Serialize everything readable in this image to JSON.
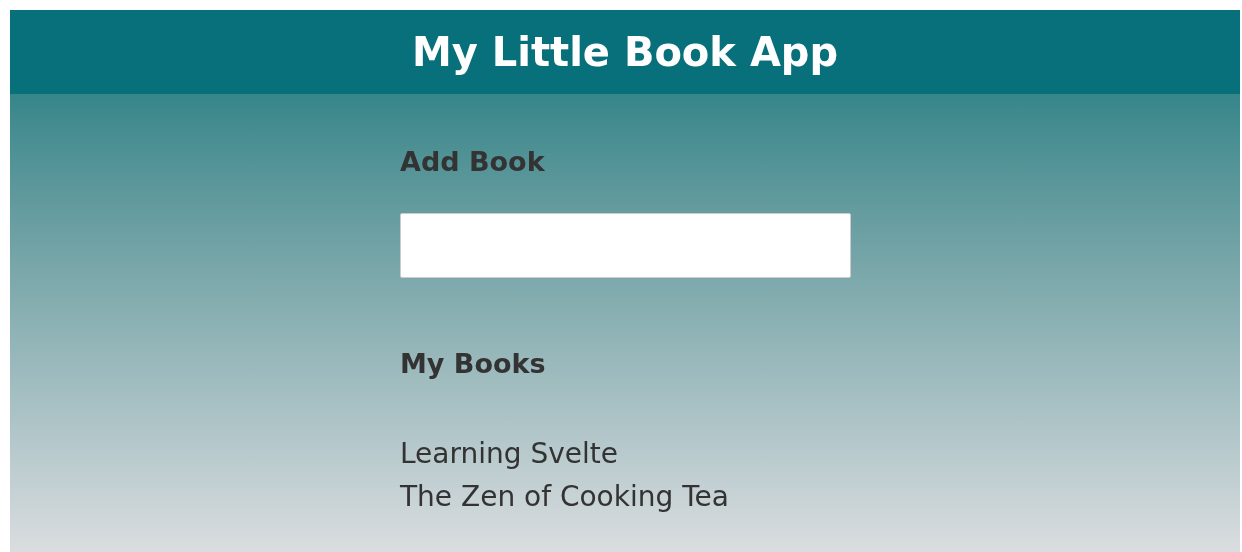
{
  "header": {
    "title": "My Little Book App"
  },
  "add_book": {
    "heading": "Add Book"
  },
  "books": {
    "heading": "My Books",
    "items": [
      "Learning Svelte",
      "The Zen of Cooking Tea"
    ]
  }
}
